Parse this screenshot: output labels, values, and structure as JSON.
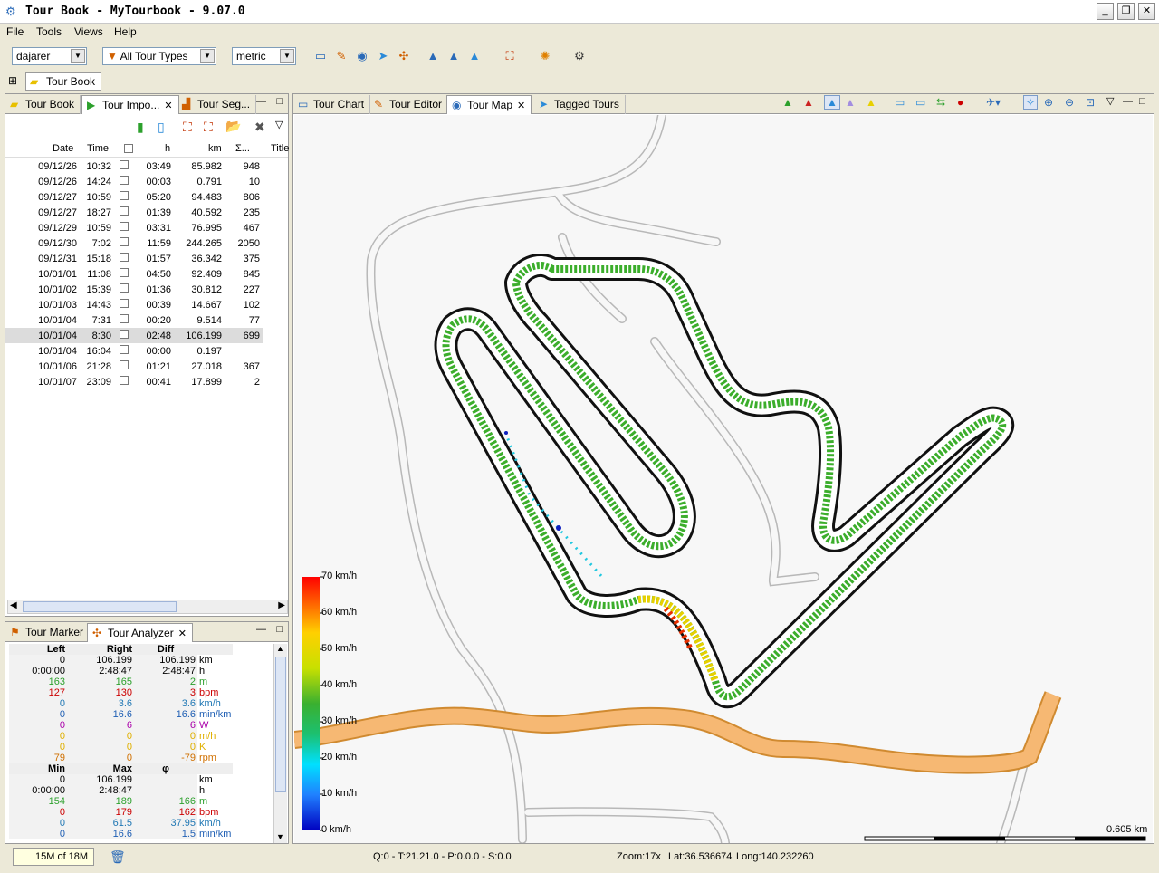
{
  "window": {
    "title": "Tour Book - MyTourbook - 9.07.0"
  },
  "menu": [
    "File",
    "Tools",
    "Views",
    "Help"
  ],
  "toolbar": {
    "person": "dajarer",
    "tour_type": "All Tour Types",
    "units": "metric"
  },
  "perspective": {
    "label": "Tour Book"
  },
  "left_tabs": [
    "Tour Book",
    "Tour Impo...",
    "Tour Seg..."
  ],
  "table": {
    "headers": [
      "Date",
      "Time",
      "h",
      "km",
      "Σ...",
      "Title"
    ],
    "rows": [
      [
        "09/12/26",
        "10:32",
        "03:49",
        "85.982",
        "948"
      ],
      [
        "09/12/26",
        "14:24",
        "00:03",
        "0.791",
        "10"
      ],
      [
        "09/12/27",
        "10:59",
        "05:20",
        "94.483",
        "806"
      ],
      [
        "09/12/27",
        "18:27",
        "01:39",
        "40.592",
        "235"
      ],
      [
        "09/12/29",
        "10:59",
        "03:31",
        "76.995",
        "467"
      ],
      [
        "09/12/30",
        "7:02",
        "11:59",
        "244.265",
        "2050"
      ],
      [
        "09/12/31",
        "15:18",
        "01:57",
        "36.342",
        "375"
      ],
      [
        "10/01/01",
        "11:08",
        "04:50",
        "92.409",
        "845"
      ],
      [
        "10/01/02",
        "15:39",
        "01:36",
        "30.812",
        "227"
      ],
      [
        "10/01/03",
        "14:43",
        "00:39",
        "14.667",
        "102"
      ],
      [
        "10/01/04",
        "7:31",
        "00:20",
        "9.514",
        "77"
      ],
      [
        "10/01/04",
        "8:30",
        "02:48",
        "106.199",
        "699"
      ],
      [
        "10/01/04",
        "16:04",
        "00:00",
        "0.197",
        ""
      ],
      [
        "10/01/06",
        "21:28",
        "01:21",
        "27.018",
        "367"
      ],
      [
        "10/01/07",
        "23:09",
        "00:41",
        "17.899",
        "2"
      ]
    ]
  },
  "bottom_tabs": [
    "Tour Marker",
    "Tour Analyzer"
  ],
  "analyzer": {
    "head1": [
      "Left",
      "Right",
      "Diff"
    ],
    "rows1": [
      [
        "0",
        "106.199",
        "106.199",
        "km",
        "#000000"
      ],
      [
        "0:00:00",
        "2:48:47",
        "2:48:47",
        "h",
        "#000000"
      ],
      [
        "163",
        "165",
        "2",
        "m",
        "#2ca02c"
      ],
      [
        "127",
        "130",
        "3",
        "bpm",
        "#cc0000"
      ],
      [
        "0",
        "3.6",
        "3.6",
        "km/h",
        "#1f77b4"
      ],
      [
        "0",
        "16.6",
        "16.6",
        "min/km",
        "#1f5fb4"
      ],
      [
        "0",
        "6",
        "6",
        "W",
        "#aa00aa"
      ],
      [
        "0",
        "0",
        "0",
        "m/h",
        "#e0b000"
      ],
      [
        "0",
        "0",
        "0",
        "K",
        "#e0b000"
      ],
      [
        "79",
        "0",
        "-79",
        "rpm",
        "#d07000"
      ]
    ],
    "head2": [
      "Min",
      "Max",
      "φ"
    ],
    "rows2": [
      [
        "0",
        "106.199",
        "",
        "km",
        "#000000"
      ],
      [
        "0:00:00",
        "2:48:47",
        "",
        "h",
        "#000000"
      ],
      [
        "154",
        "189",
        "166",
        "m",
        "#2ca02c"
      ],
      [
        "0",
        "179",
        "162",
        "bpm",
        "#cc0000"
      ],
      [
        "0",
        "61.5",
        "37.95",
        "km/h",
        "#1f77b4"
      ],
      [
        "0",
        "16.6",
        "1.5",
        "min/km",
        "#1f5fb4"
      ]
    ]
  },
  "right_tabs": [
    "Tour Chart",
    "Tour Editor",
    "Tour Map",
    "Tagged Tours"
  ],
  "map": {
    "legend": [
      "70 km/h",
      "60 km/h",
      "50 km/h",
      "40 km/h",
      "30 km/h",
      "20 km/h",
      "10 km/h",
      "0 km/h"
    ],
    "scale": "0.605 km"
  },
  "status": {
    "memory": "15M of 18M",
    "tour_info": "Q:0 - T:21.21.0 - P:0.0.0 - S:0.0",
    "zoom": "Zoom:17x",
    "lat": "Lat:36.536674",
    "long": "Long:140.232260"
  }
}
